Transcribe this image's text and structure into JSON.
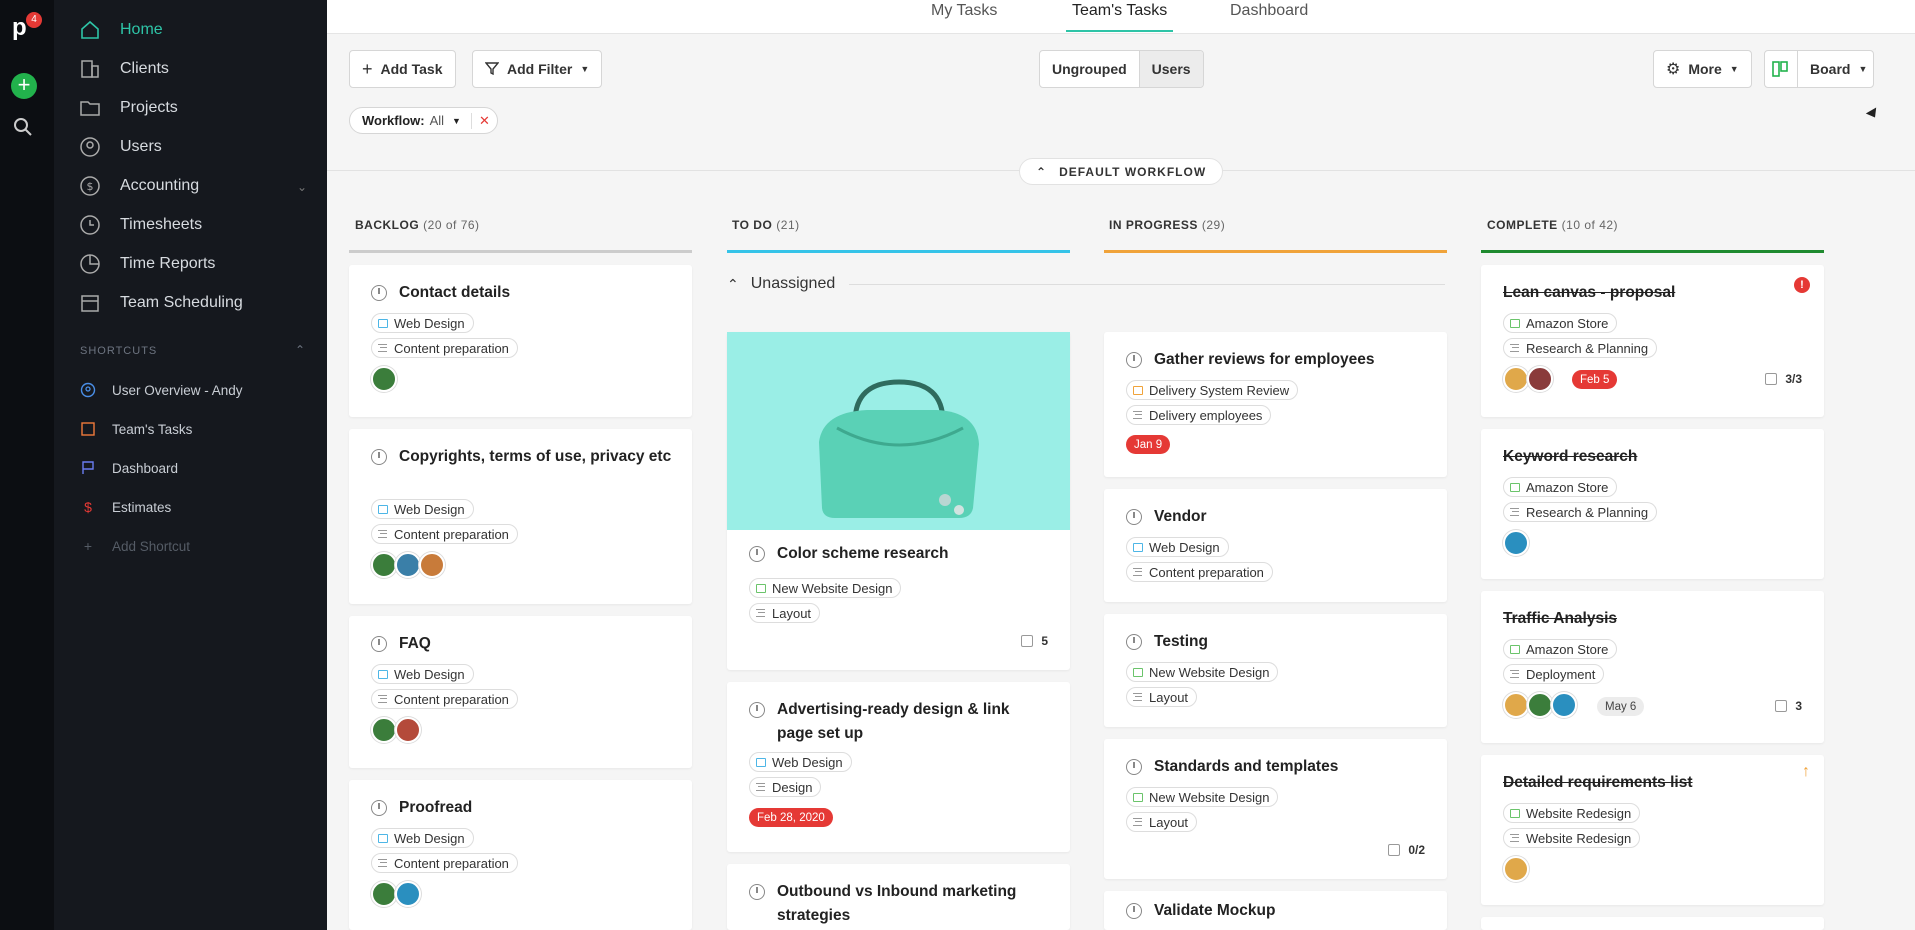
{
  "app": {
    "badge_count": "4"
  },
  "sidebar": {
    "nav": [
      {
        "label": "Home",
        "icon": "home-icon"
      },
      {
        "label": "Clients",
        "icon": "clients-icon"
      },
      {
        "label": "Projects",
        "icon": "folder-icon"
      },
      {
        "label": "Users",
        "icon": "user-icon"
      },
      {
        "label": "Accounting",
        "icon": "dollar-icon"
      },
      {
        "label": "Timesheets",
        "icon": "clock-icon"
      },
      {
        "label": "Time Reports",
        "icon": "pie-chart-icon"
      },
      {
        "label": "Team Scheduling",
        "icon": "calendar-icon"
      }
    ],
    "shortcuts_header": "SHORTCUTS",
    "shortcuts": [
      {
        "label": "User Overview - Andy"
      },
      {
        "label": "Team's Tasks"
      },
      {
        "label": "Dashboard"
      },
      {
        "label": "Estimates"
      },
      {
        "label": "Add Shortcut"
      }
    ]
  },
  "tabs": [
    "My Tasks",
    "Team's Tasks",
    "Dashboard"
  ],
  "toolbar": {
    "add_task": "Add Task",
    "add_filter": "Add Filter",
    "ungrouped": "Ungrouped",
    "users": "Users",
    "more": "More",
    "board": "Board",
    "filter_label": "Workflow:",
    "filter_value": "All"
  },
  "workflow_label": "DEFAULT WORKFLOW",
  "columns": [
    {
      "name": "BACKLOG",
      "count": "(20 of 76)",
      "color": "#cccccc"
    },
    {
      "name": "TO DO",
      "count": "(21)",
      "color": "#35c3e8"
    },
    {
      "name": "IN PROGRESS",
      "count": "(29)",
      "color": "#f0a33a"
    },
    {
      "name": "COMPLETE",
      "count": "(10 of 42)",
      "color": "#1f8a2f"
    }
  ],
  "unassigned_label": "Unassigned",
  "cards": {
    "backlog": [
      {
        "title": "Contact details",
        "tag1": "Web Design",
        "tag2": "Content preparation"
      },
      {
        "title": "Copyrights, terms of use, privacy etc",
        "tag1": "Web Design",
        "tag2": "Content preparation"
      },
      {
        "title": "FAQ",
        "tag1": "Web Design",
        "tag2": "Content preparation"
      },
      {
        "title": "Proofread",
        "tag1": "Web Design",
        "tag2": "Content preparation"
      }
    ],
    "todo": [
      {
        "title": "Color scheme research",
        "tag1": "New Website Design",
        "tag2": "Layout",
        "meta": "5"
      },
      {
        "title": "Advertising-ready design & link page set up",
        "tag1": "Web Design",
        "tag2": "Design",
        "date": "Feb 28, 2020"
      },
      {
        "title": "Outbound vs Inbound marketing strategies"
      }
    ],
    "inprogress": [
      {
        "title": "Gather reviews for employees",
        "tag1": "Delivery System Review",
        "tag2": "Delivery employees",
        "date": "Jan 9"
      },
      {
        "title": "Vendor",
        "tag1": "Web Design",
        "tag2": "Content preparation"
      },
      {
        "title": "Testing",
        "tag1": "New Website Design",
        "tag2": "Layout"
      },
      {
        "title": "Standards and templates",
        "tag1": "New Website Design",
        "tag2": "Layout",
        "meta": "0/2"
      },
      {
        "title": "Validate Mockup"
      }
    ],
    "complete": [
      {
        "title": "Lean canvas - proposal",
        "tag1": "Amazon Store",
        "tag2": "Research & Planning",
        "date": "Feb 5",
        "meta": "3/3"
      },
      {
        "title": "Keyword research",
        "tag1": "Amazon Store",
        "tag2": "Research & Planning"
      },
      {
        "title": "Traffic Analysis",
        "tag1": "Amazon Store",
        "tag2": "Deployment",
        "date": "May 6",
        "meta": "3"
      },
      {
        "title": "Detailed requirements list",
        "tag1": "Website Redesign",
        "tag2": "Website Redesign"
      }
    ]
  }
}
